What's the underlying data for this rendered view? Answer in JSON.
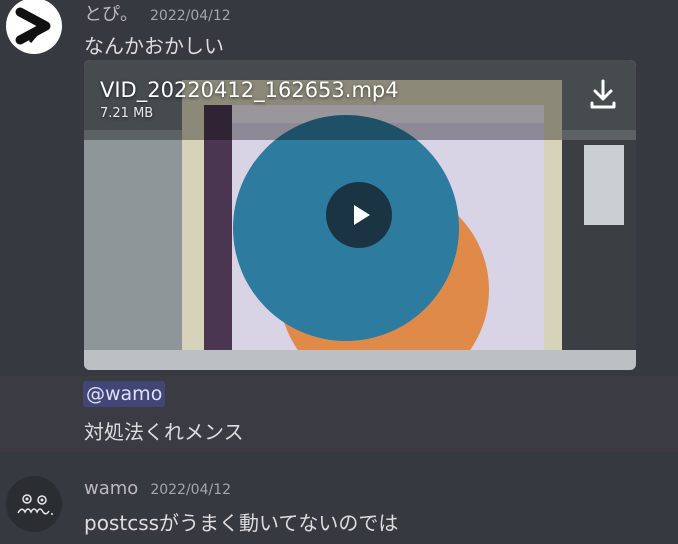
{
  "messages": [
    {
      "author": "とぴ。",
      "timestamp": "2022/04/12",
      "text": "なんかおかしい",
      "attachment": {
        "filename": "VID_20220412_162653.mp4",
        "size": "7.21 MB"
      }
    },
    {
      "mention": "@wamo",
      "text": "対処法くれメンス"
    },
    {
      "author": "wamo",
      "timestamp": "2022/04/12",
      "text": "postcssがうまく動いてないのでは"
    }
  ],
  "colors": {
    "background": "#36393f",
    "mention_bg": "#414675",
    "mention_text": "#dee0fc",
    "video_circle_blue": "#2e7ba0",
    "video_circle_orange": "#e08a4a"
  },
  "icons": [
    "tobi-avatar",
    "download-icon",
    "play-icon",
    "wamo-avatar"
  ]
}
